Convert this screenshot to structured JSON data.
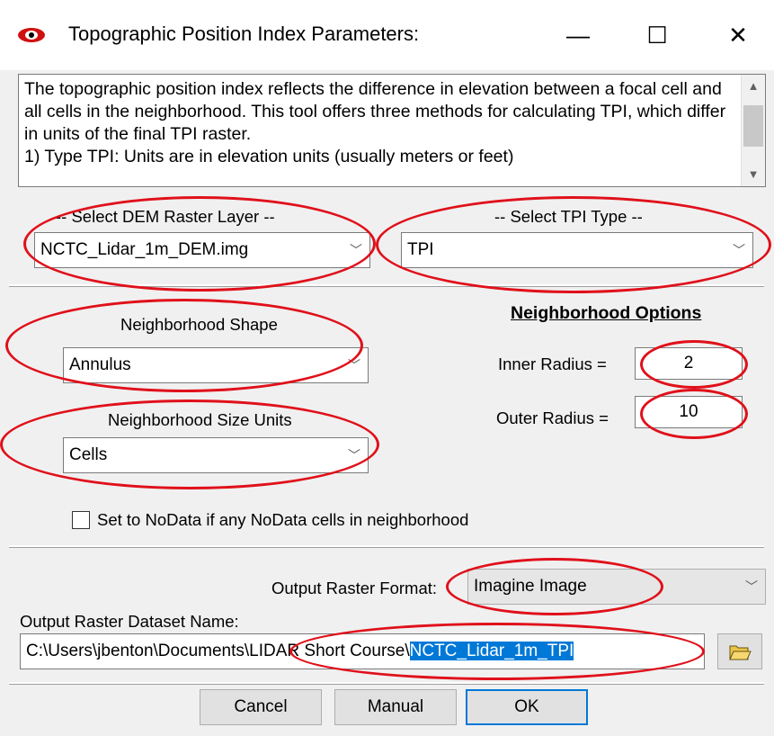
{
  "window": {
    "title": "Topographic Position Index Parameters:",
    "minimize_glyph": "—",
    "maximize_glyph": "☐",
    "close_glyph": "✕"
  },
  "description": {
    "text": "The topographic position index reflects the difference in elevation between a focal cell and all cells in the neighborhood.  This tool offers three methods for calculating TPI, which differ in units of the final TPI raster.\n1) Type TPI: Units are in elevation units (usually meters or feet)"
  },
  "dem": {
    "label": "-- Select DEM Raster Layer --",
    "value": "NCTC_Lidar_1m_DEM.img"
  },
  "tpi_type": {
    "label": "-- Select TPI Type --",
    "value": "TPI"
  },
  "neighborhood": {
    "options_heading": "Neighborhood Options",
    "shape_label": "Neighborhood Shape",
    "shape_value": "Annulus",
    "size_units_label": "Neighborhood Size Units",
    "size_units_value": "Cells",
    "inner_radius_label": "Inner Radius =",
    "inner_radius_value": "2",
    "outer_radius_label": "Outer Radius =",
    "outer_radius_value": "10",
    "nodata_label": "Set to NoData if any NoData cells in neighborhood",
    "nodata_checked": false
  },
  "output": {
    "format_label": "Output Raster Format:",
    "format_value": "Imagine Image",
    "dataset_label": "Output Raster Dataset Name:",
    "path_prefix": "C:\\Users\\jbenton\\Documents\\LIDAR Short Course\\",
    "path_selected": "NCTC_Lidar_1m_TPI"
  },
  "buttons": {
    "cancel": "Cancel",
    "manual": "Manual",
    "ok": "OK"
  },
  "colors": {
    "annotation": "#e0101a",
    "selection": "#0078d7"
  },
  "icons": {
    "app": "red-eye-icon",
    "browse": "open-folder-icon"
  }
}
